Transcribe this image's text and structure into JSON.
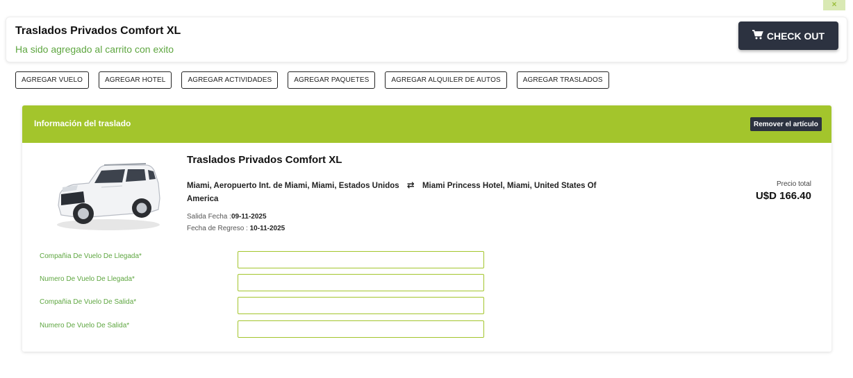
{
  "close_label": "×",
  "notice": {
    "title": "Traslados Privados Comfort XL",
    "message": "Ha sido agregado al carrito con exito",
    "checkout_label": "CHECK OUT"
  },
  "add_buttons": [
    "AGREGAR VUELO",
    "AGREGAR HOTEL",
    "AGREGAR ACTIVIDADES",
    "AGREGAR PAQUETES",
    "AGREGAR ALQUILER DE AUTOS",
    "AGREGAR TRASLADOS"
  ],
  "card": {
    "header_title": "Información del traslado",
    "remove_label": "Remover el artículo",
    "product_title": "Traslados Privados Comfort XL",
    "origin": "Miami, Aeropuerto Int. de Miami, Miami, Estados Unidos",
    "destination": "Miami Princess Hotel, Miami, United States Of America",
    "departure_label": "Salida Fecha :",
    "departure_date": "09-11-2025",
    "return_label": "Fecha de Regreso : ",
    "return_date": "10-11-2025",
    "price_label": "Precio total",
    "price_value": "U$D 166.40"
  },
  "fields": [
    {
      "label": "Compañia De Vuelo De Llegada*",
      "value": ""
    },
    {
      "label": "Numero De Vuelo De Llegada*",
      "value": ""
    },
    {
      "label": "Compañia De Vuelo De Salida*",
      "value": ""
    },
    {
      "label": "Numero De Vuelo De Salida*",
      "value": ""
    }
  ],
  "colors": {
    "accent_green": "#a3c52c",
    "success_text": "#5ea640",
    "dark_button": "#2c3240"
  },
  "icons": {
    "checkout": "cart-icon",
    "route": "swap-arrows-icon"
  }
}
